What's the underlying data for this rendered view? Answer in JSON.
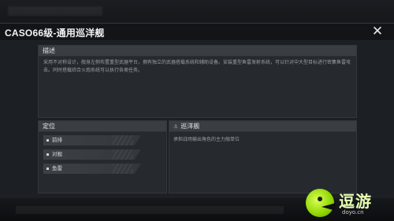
{
  "modal": {
    "title": "CASO66级-通用巡洋舰",
    "close_symbol": "✕"
  },
  "description": {
    "header": "描述",
    "text": "采用不对称设计，舰身左侧布置重型武器平台，拥有独立的武器搭载系统和辅助设备。安装重型鱼雷发射系统，可以针对中大型目标进行密集鱼雷攻击。同时搭载综合火炮系统可以执行各类任务。"
  },
  "positioning": {
    "header": "定位",
    "items": [
      {
        "label": "前排"
      },
      {
        "label": "对舰"
      },
      {
        "label": "鱼雷"
      }
    ]
  },
  "role": {
    "header": "巡洋舰",
    "icon": "ship-icon",
    "text": "承担战场输出角色的主力舰单位"
  },
  "watermark": {
    "brand": "逗游",
    "url": "doyo.cn"
  }
}
